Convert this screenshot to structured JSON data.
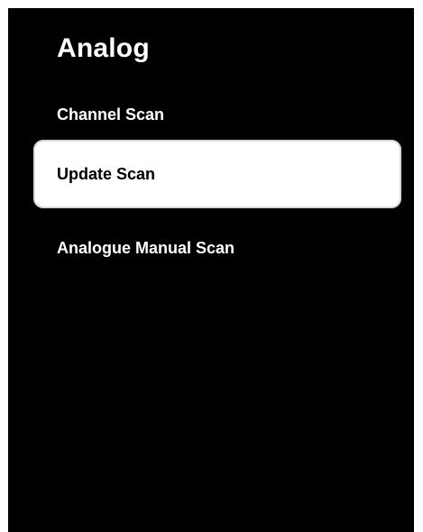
{
  "menu": {
    "title": "Analog",
    "items": [
      {
        "label": "Channel Scan"
      },
      {
        "label": "Update Scan",
        "selected": true
      },
      {
        "label": "Analogue Manual Scan"
      }
    ]
  },
  "colors": {
    "background": "#000000",
    "text": "#ffffff",
    "highlight": "#ffffff",
    "highlight_text": "#000000"
  }
}
